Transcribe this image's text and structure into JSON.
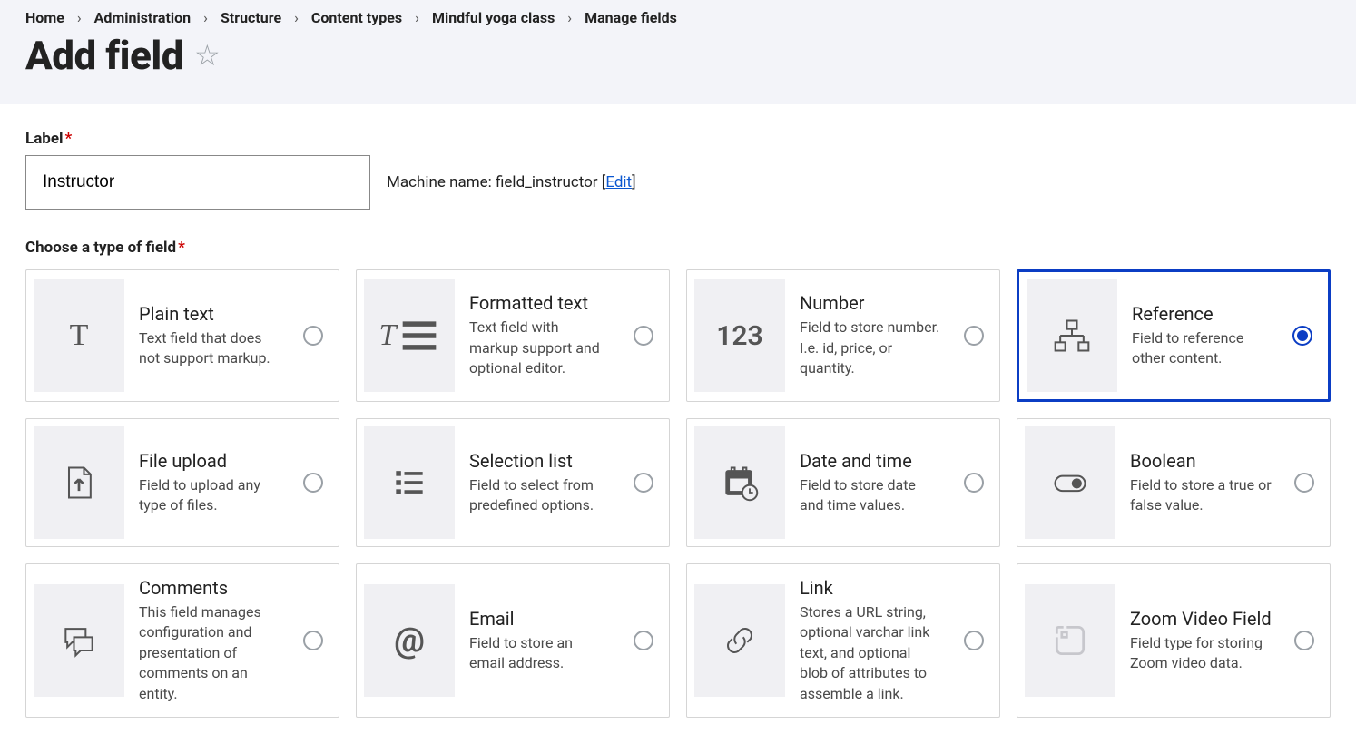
{
  "breadcrumbs": [
    "Home",
    "Administration",
    "Structure",
    "Content types",
    "Mindful yoga class",
    "Manage fields"
  ],
  "page_title": "Add field",
  "label_field": {
    "label": "Label",
    "value": "Instructor"
  },
  "machine_name": {
    "prefix": "Machine name:",
    "value": "field_instructor",
    "edit": "Edit"
  },
  "choose_label": "Choose a type of field",
  "field_types": [
    {
      "id": "plain_text",
      "title": "Plain text",
      "desc": "Text field that does not support markup.",
      "selected": false
    },
    {
      "id": "formatted_text",
      "title": "Formatted text",
      "desc": "Text field with markup support and optional editor.",
      "selected": false
    },
    {
      "id": "number",
      "title": "Number",
      "desc": "Field to store number. I.e. id, price, or quantity.",
      "selected": false
    },
    {
      "id": "reference",
      "title": "Reference",
      "desc": "Field to reference other content.",
      "selected": true
    },
    {
      "id": "file_upload",
      "title": "File upload",
      "desc": "Field to upload any type of files.",
      "selected": false
    },
    {
      "id": "selection_list",
      "title": "Selection list",
      "desc": "Field to select from predefined options.",
      "selected": false
    },
    {
      "id": "date_time",
      "title": "Date and time",
      "desc": "Field to store date and time values.",
      "selected": false
    },
    {
      "id": "boolean",
      "title": "Boolean",
      "desc": "Field to store a true or false value.",
      "selected": false
    },
    {
      "id": "comments",
      "title": "Comments",
      "desc": "This field manages configuration and presentation of comments on an entity.",
      "selected": false
    },
    {
      "id": "email",
      "title": "Email",
      "desc": "Field to store an email address.",
      "selected": false
    },
    {
      "id": "link",
      "title": "Link",
      "desc": "Stores a URL string, optional varchar link text, and optional blob of attributes to assemble a link.",
      "selected": false
    },
    {
      "id": "zoom_video",
      "title": "Zoom Video Field",
      "desc": "Field type for storing Zoom video data.",
      "selected": false
    }
  ]
}
